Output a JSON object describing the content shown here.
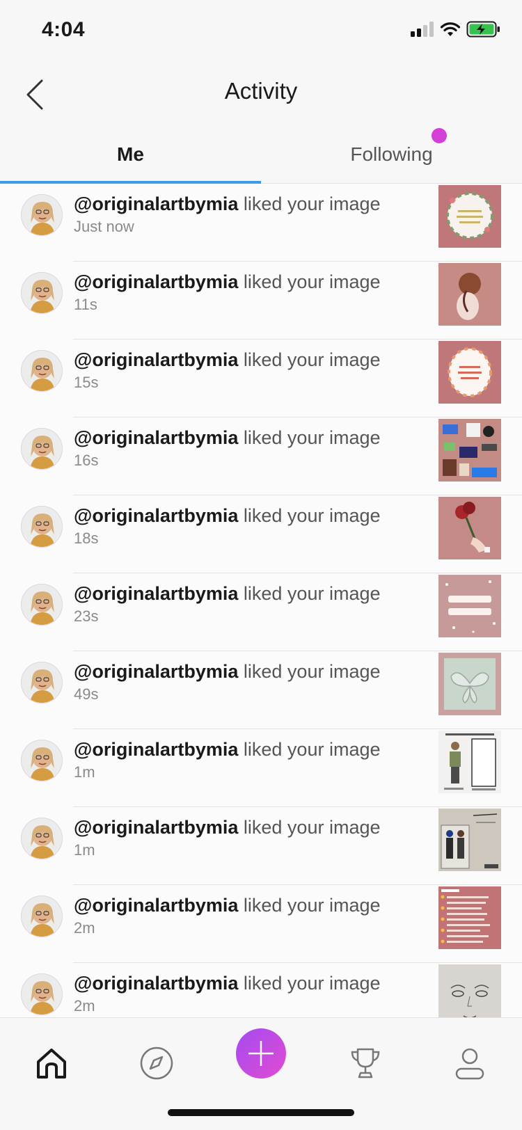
{
  "status_bar": {
    "time": "4:04"
  },
  "header": {
    "title": "Activity"
  },
  "tabs": [
    {
      "label": "Me"
    },
    {
      "label": "Following"
    }
  ],
  "activity": [
    {
      "username": "@originalartbymia",
      "action": "liked your image",
      "time": "Just now",
      "thumb_bg": "#c0777a"
    },
    {
      "username": "@originalartbymia",
      "action": "liked your image",
      "time": "11s",
      "thumb_bg": "#c68b85"
    },
    {
      "username": "@originalartbymia",
      "action": "liked your image",
      "time": "15s",
      "thumb_bg": "#c0777a"
    },
    {
      "username": "@originalartbymia",
      "action": "liked your image",
      "time": "16s",
      "thumb_bg": "#c28b84"
    },
    {
      "username": "@originalartbymia",
      "action": "liked your image",
      "time": "18s",
      "thumb_bg": "#c38a88"
    },
    {
      "username": "@originalartbymia",
      "action": "liked your image",
      "time": "23s",
      "thumb_bg": "#c79a9a"
    },
    {
      "username": "@originalartbymia",
      "action": "liked your image",
      "time": "49s",
      "thumb_bg": "#c9a19e"
    },
    {
      "username": "@originalartbymia",
      "action": "liked your image",
      "time": "1m",
      "thumb_bg": "#f3f1ef"
    },
    {
      "username": "@originalartbymia",
      "action": "liked your image",
      "time": "1m",
      "thumb_bg": "#cdc7be"
    },
    {
      "username": "@originalartbymia",
      "action": "liked your image",
      "time": "2m",
      "thumb_bg": "#c27375"
    },
    {
      "username": "@originalartbymia",
      "action": "liked your image",
      "time": "2m",
      "thumb_bg": "#d8d5d0"
    }
  ],
  "bottom_nav": [
    {
      "icon": "home-icon"
    },
    {
      "icon": "compass-icon"
    },
    {
      "icon": "plus-icon"
    },
    {
      "icon": "trophy-icon"
    },
    {
      "icon": "profile-icon"
    }
  ],
  "colors": {
    "accent_blue": "#3d9be9",
    "notification_dot": "#d23fd9",
    "plus_gradient_start": "#a44bf0",
    "plus_gradient_end": "#e14bd3"
  }
}
